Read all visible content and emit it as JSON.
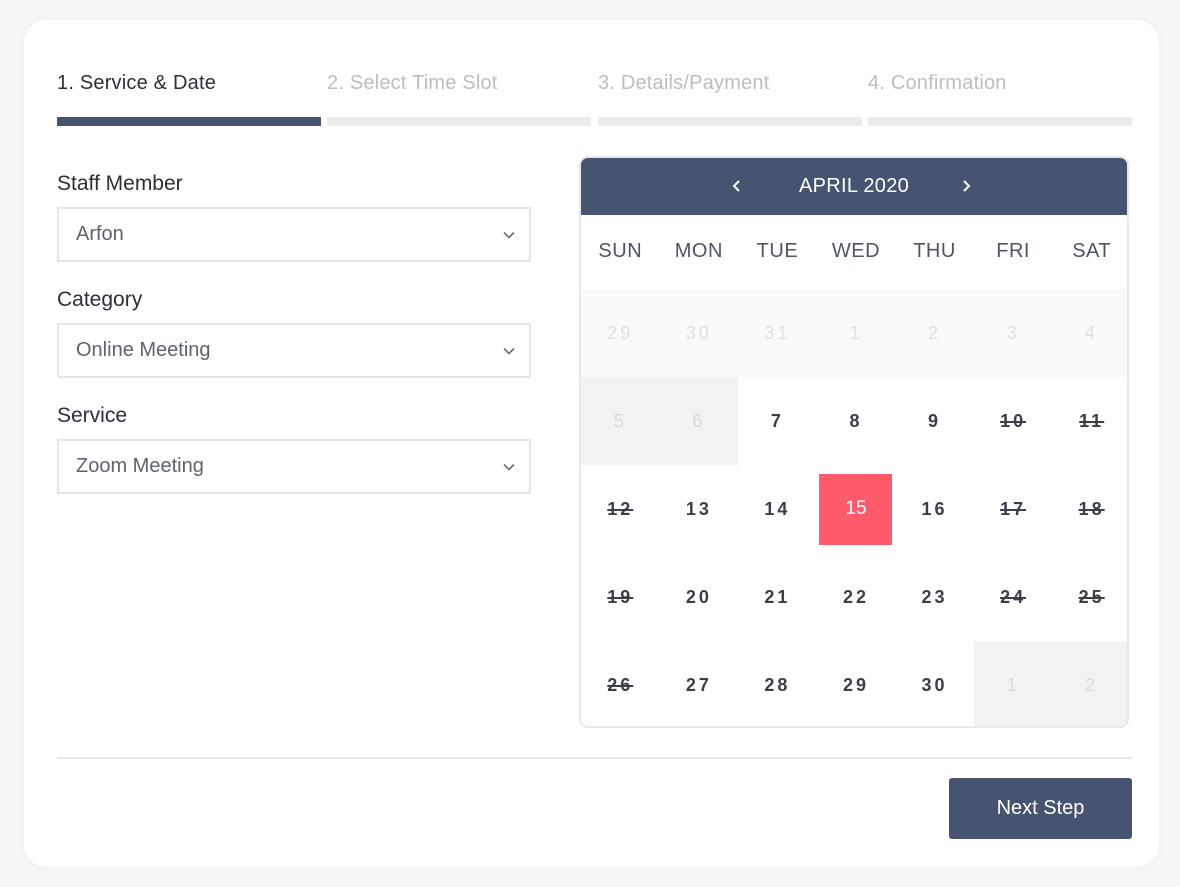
{
  "steps": [
    {
      "label": "1. Service & Date",
      "active": true
    },
    {
      "label": "2. Select Time Slot",
      "active": false
    },
    {
      "label": "3. Details/Payment",
      "active": false
    },
    {
      "label": "4. Confirmation",
      "active": false
    }
  ],
  "form": {
    "staff": {
      "label": "Staff Member",
      "value": "Arfon"
    },
    "category": {
      "label": "Category",
      "value": "Online Meeting"
    },
    "service": {
      "label": "Service",
      "value": "Zoom Meeting"
    }
  },
  "calendar": {
    "title": "APRIL 2020",
    "weekdays": [
      "SUN",
      "MON",
      "TUE",
      "WED",
      "THU",
      "FRI",
      "SAT"
    ],
    "days": [
      {
        "n": "29",
        "state": "gray"
      },
      {
        "n": "30",
        "state": "gray"
      },
      {
        "n": "31",
        "state": "gray"
      },
      {
        "n": "1",
        "state": "gray"
      },
      {
        "n": "2",
        "state": "gray"
      },
      {
        "n": "3",
        "state": "gray"
      },
      {
        "n": "4",
        "state": "gray"
      },
      {
        "n": "5",
        "state": "dark-gray"
      },
      {
        "n": "6",
        "state": "dark-gray"
      },
      {
        "n": "7",
        "state": "available"
      },
      {
        "n": "8",
        "state": "available"
      },
      {
        "n": "9",
        "state": "available"
      },
      {
        "n": "10",
        "state": "strike"
      },
      {
        "n": "11",
        "state": "strike"
      },
      {
        "n": "12",
        "state": "strike"
      },
      {
        "n": "13",
        "state": "available"
      },
      {
        "n": "14",
        "state": "available"
      },
      {
        "n": "15",
        "state": "selected"
      },
      {
        "n": "16",
        "state": "available"
      },
      {
        "n": "17",
        "state": "strike"
      },
      {
        "n": "18",
        "state": "strike"
      },
      {
        "n": "19",
        "state": "strike"
      },
      {
        "n": "20",
        "state": "available"
      },
      {
        "n": "21",
        "state": "available"
      },
      {
        "n": "22",
        "state": "available"
      },
      {
        "n": "23",
        "state": "available"
      },
      {
        "n": "24",
        "state": "strike"
      },
      {
        "n": "25",
        "state": "strike"
      },
      {
        "n": "26",
        "state": "strike"
      },
      {
        "n": "27",
        "state": "available"
      },
      {
        "n": "28",
        "state": "available"
      },
      {
        "n": "29",
        "state": "available"
      },
      {
        "n": "30",
        "state": "available"
      },
      {
        "n": "1",
        "state": "dark-gray"
      },
      {
        "n": "2",
        "state": "dark-gray"
      }
    ]
  },
  "actions": {
    "next_label": "Next Step"
  },
  "colors": {
    "primary": "#475471",
    "selected": "#ff5a6a"
  },
  "icons": {
    "dropdown": "chevron-down-icon",
    "prev": "chevron-left-icon",
    "next": "chevron-right-icon"
  }
}
